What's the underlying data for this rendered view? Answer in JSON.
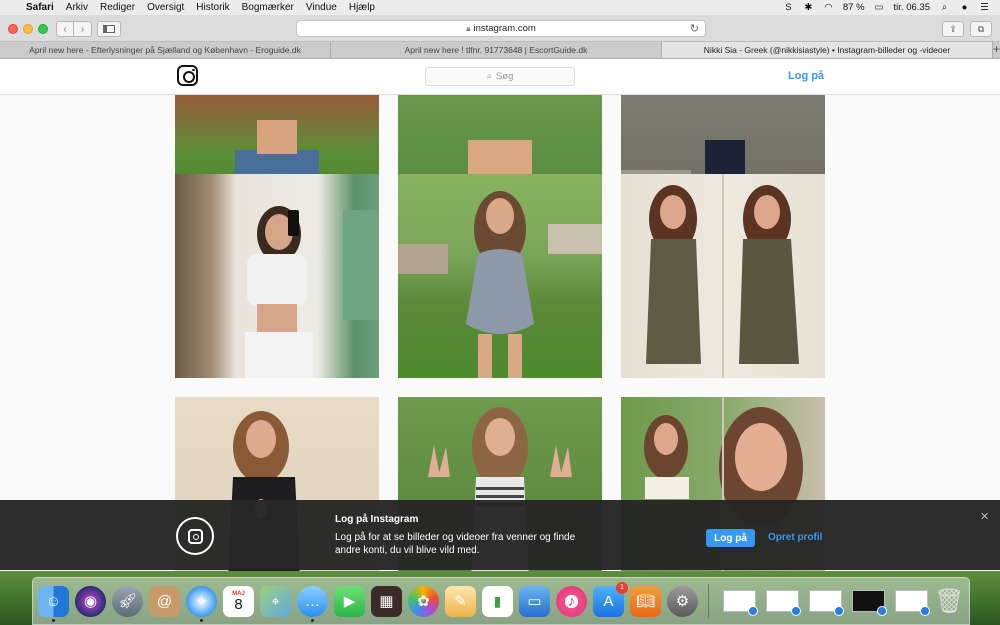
{
  "menubar": {
    "app": "Safari",
    "items": [
      "Arkiv",
      "Rediger",
      "Oversigt",
      "Historik",
      "Bogmærker",
      "Vindue",
      "Hjælp"
    ],
    "battery": "87 %",
    "clock": "tir. 06.35"
  },
  "toolbar": {
    "url": "instagram.com"
  },
  "tabs": [
    "April new here - Efterlysninger på Sjælland og København - Eroguide.dk",
    "April new here ! tlfnr. 91773648 | EscortGuide.dk",
    "Nikki Sia - Greek (@nikkisiastyle) • Instagram-billeder og -videoer"
  ],
  "instagram": {
    "search_placeholder": "Søg",
    "login_link": "Log på"
  },
  "banner": {
    "title": "Log på Instagram",
    "message": "Log på for at se billeder og videoer fra venner og finde andre konti, du vil blive vild med.",
    "login_button": "Log på",
    "create_link": "Opret profil"
  },
  "dock": {
    "calendar_month": "MAJ",
    "calendar_day": "8",
    "appstore_badge": "1"
  }
}
